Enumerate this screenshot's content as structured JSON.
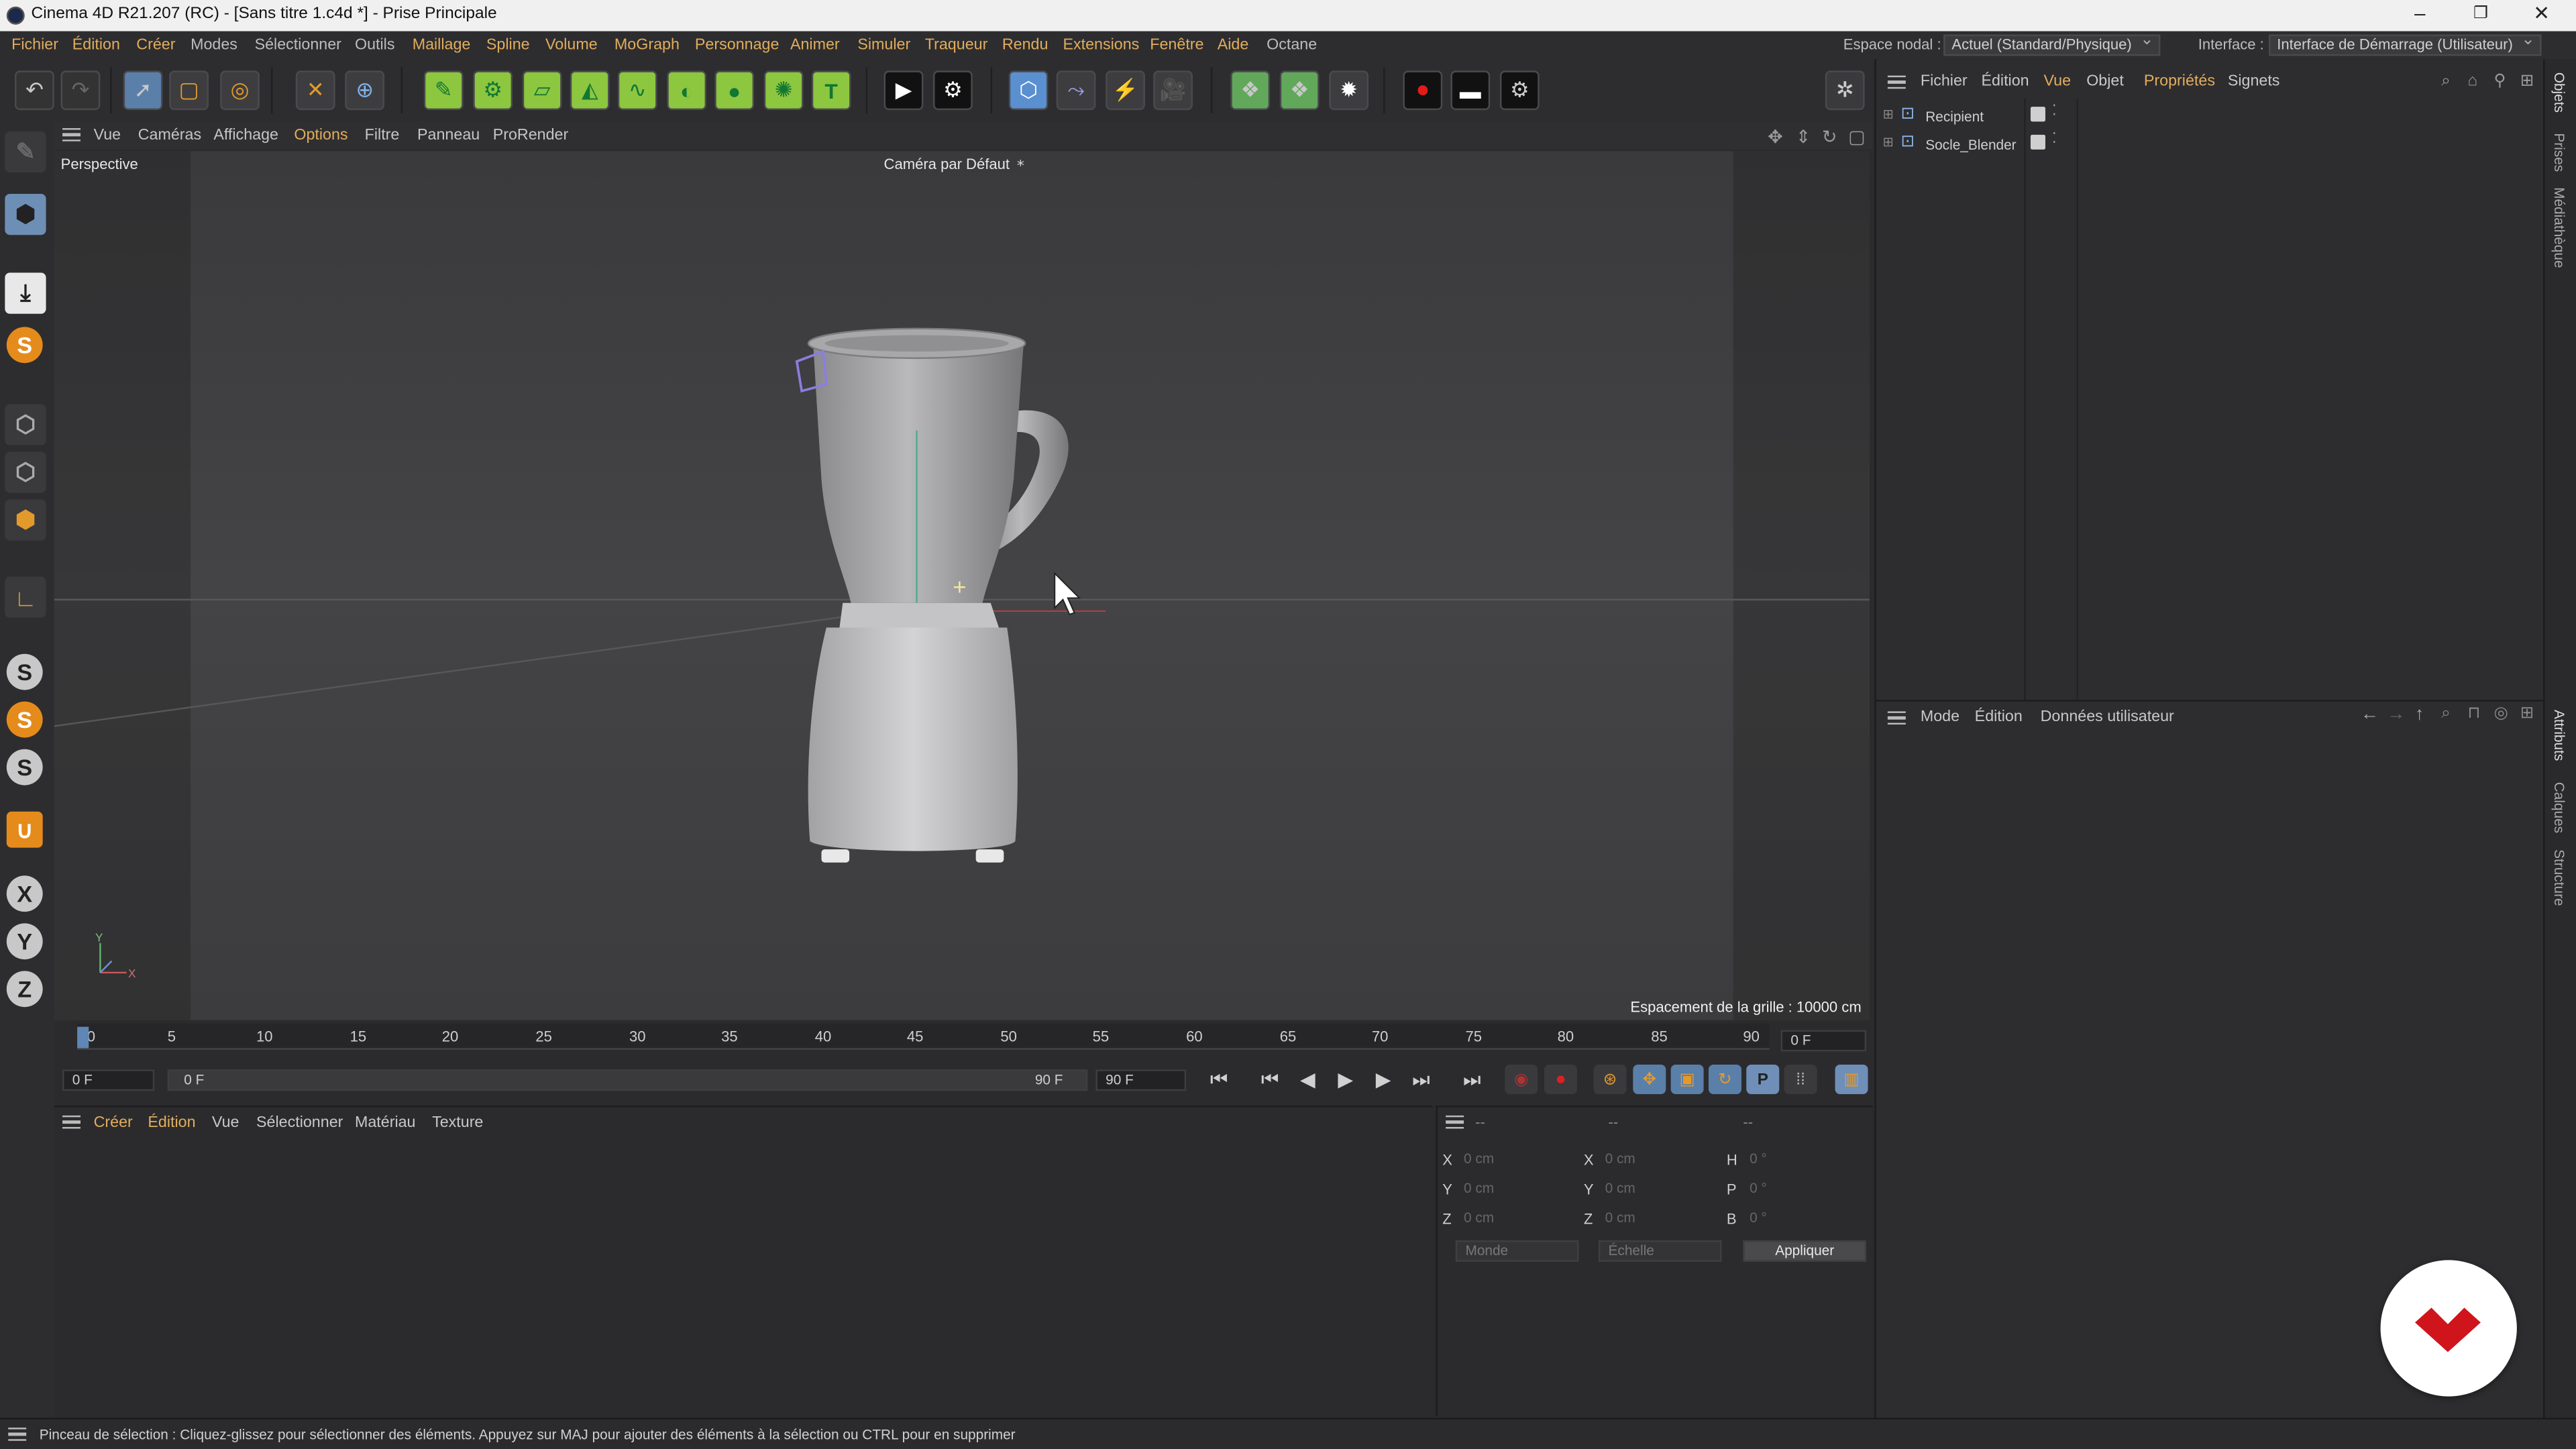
{
  "window": {
    "title": "Cinema 4D R21.207 (RC) - [Sans titre 1.c4d *] - Prise Principale"
  },
  "menu": {
    "items": [
      "Fichier",
      "Édition",
      "Créer",
      "Modes",
      "Sélectionner",
      "Outils",
      "Maillage",
      "Spline",
      "Volume",
      "MoGraph",
      "Personnage",
      "Animer",
      "Simuler",
      "Traqueur",
      "Rendu",
      "Extensions",
      "Fenêtre",
      "Aide",
      "Octane"
    ],
    "node_space_label": "Espace nodal :",
    "node_space_value": "Actuel (Standard/Physique)",
    "interface_label": "Interface :",
    "interface_value": "Interface de Démarrage (Utilisateur)"
  },
  "viewport": {
    "menu": [
      "Vue",
      "Caméras",
      "Affichage",
      "Options",
      "Filtre",
      "Panneau",
      "ProRender"
    ],
    "label": "Perspective",
    "camera": "Caméra par Défaut",
    "grid_spacing": "Espacement de la grille : 10000 cm",
    "axis_x": "X",
    "axis_y": "Y"
  },
  "timeline": {
    "ticks": [
      "0",
      "5",
      "10",
      "15",
      "20",
      "25",
      "30",
      "35",
      "40",
      "45",
      "50",
      "55",
      "60",
      "65",
      "70",
      "75",
      "80",
      "85",
      "90"
    ],
    "current_frame": "0 F",
    "start_field": "0 F",
    "range_start": "0 F",
    "range_end": "90 F",
    "end_field": "90 F"
  },
  "materials": {
    "menu": [
      "Créer",
      "Édition",
      "Vue",
      "Sélectionner",
      "Matériau",
      "Texture"
    ]
  },
  "coordinates": {
    "headers": [
      "--",
      "--",
      "--"
    ],
    "rows": [
      {
        "a": "X",
        "av": "0 cm",
        "b": "X",
        "bv": "0 cm",
        "c": "H",
        "cv": "0 °"
      },
      {
        "a": "Y",
        "av": "0 cm",
        "b": "Y",
        "bv": "0 cm",
        "c": "P",
        "cv": "0 °"
      },
      {
        "a": "Z",
        "av": "0 cm",
        "b": "Z",
        "bv": "0 cm",
        "c": "B",
        "cv": "0 °"
      }
    ],
    "world": "Monde",
    "scale": "Échelle",
    "apply": "Appliquer"
  },
  "objects": {
    "menu": [
      "Fichier",
      "Édition",
      "Vue",
      "Objet",
      "Propriétés",
      "Signets"
    ],
    "items": [
      "Recipient",
      "Socle_Blender"
    ]
  },
  "attributes": {
    "menu": [
      "Mode",
      "Édition",
      "Données utilisateur"
    ]
  },
  "side_tabs": [
    "Objets",
    "Prises",
    "Médiathèque",
    "Attributs",
    "Calques",
    "Structure"
  ],
  "status": {
    "text": "Pinceau de sélection : Cliquez-glissez pour sélectionner des éléments. Appuyez sur MAJ pour ajouter des éléments à la sélection ou CTRL pour en supprimer"
  },
  "colors": {
    "accent_menu": "#e2ad5c",
    "bg": "#2d2d2f",
    "record": "#d01818"
  }
}
